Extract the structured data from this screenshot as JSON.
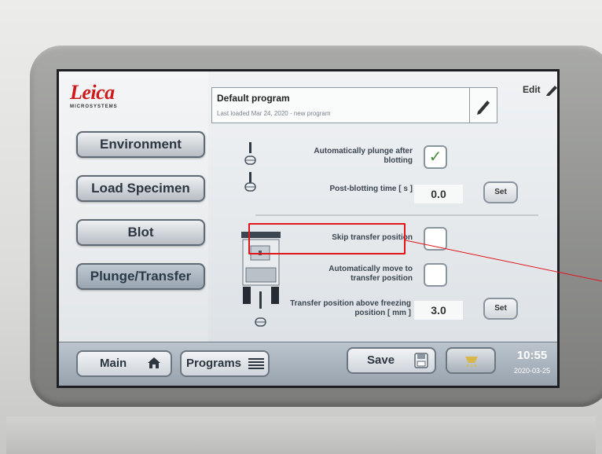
{
  "logo": {
    "word": "Leica",
    "sub": "MICROSYSTEMS"
  },
  "header": {
    "program_title": "Default program",
    "program_subtitle": "Last loaded Mar 24, 2020 - new program",
    "edit_label": "Edit"
  },
  "nav": {
    "items": [
      {
        "label": "Environment"
      },
      {
        "label": "Load Specimen"
      },
      {
        "label": "Blot"
      },
      {
        "label": "Plunge/Transfer",
        "active": true
      }
    ]
  },
  "options": {
    "auto_plunge_label": "Automatically plunge after blotting",
    "auto_plunge_checked": true,
    "post_blot_label": "Post-blotting time  [ s ]",
    "post_blot_value": "0.0",
    "skip_transfer_label": "Skip transfer position",
    "skip_transfer_checked": false,
    "auto_move_label": "Automatically move to transfer position",
    "auto_move_checked": false,
    "transfer_pos_label": "Transfer position above freezing position [ mm ]",
    "transfer_pos_value": "3.0",
    "set_label": "Set",
    "check_mark": "✓"
  },
  "bottom": {
    "main_label": "Main",
    "programs_label": "Programs",
    "save_label": "Save",
    "time": "10:55",
    "date": "2020-03-25"
  },
  "colors": {
    "logo_red": "#d0191a",
    "highlight_red": "#e0151a",
    "light_button": "#d8b64a"
  }
}
